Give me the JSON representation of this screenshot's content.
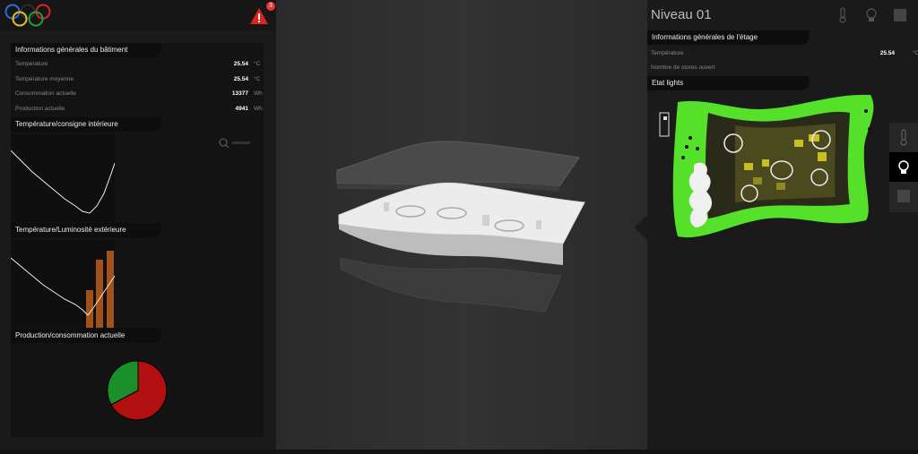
{
  "left": {
    "alert_count": "3",
    "building_info": {
      "title": "Informations générales du bâtiment",
      "rows": [
        {
          "label": "Température",
          "value": "25.54",
          "unit": "°C"
        },
        {
          "label": "Température moyenne",
          "value": "25.54",
          "unit": "°C"
        },
        {
          "label": "Consommation actuelle",
          "value": "13377",
          "unit": "Wh"
        },
        {
          "label": "Production actuelle",
          "value": "4941",
          "unit": "Wh"
        }
      ]
    },
    "temp_setpoint_title": "Température/consigne intérieure",
    "temp_light_title": "Température/Luminosité extérieure",
    "production_title": "Production/consommation actuelle",
    "production_chart": {
      "type": "pie",
      "slices": [
        {
          "label": "",
          "value": 0.33,
          "color": "#1a8f2a"
        },
        {
          "label": "",
          "value": 0.67,
          "color": "#b01010"
        }
      ]
    }
  },
  "right": {
    "level_title": "Niveau 01",
    "floor_info": {
      "title": "Informations générales de l'étage",
      "rows": [
        {
          "label": "Température",
          "value": "25.54",
          "unit": "°C"
        },
        {
          "label": "Nombre de stores ouvert",
          "value": "",
          "unit": ""
        }
      ]
    },
    "lights_title": "Etat lights"
  },
  "colors": {
    "accent_green": "#55e02a",
    "pie_green": "#1a8f2a",
    "pie_red": "#b01010",
    "bar_orange": "#a0521a",
    "alert_red": "#e33333"
  }
}
